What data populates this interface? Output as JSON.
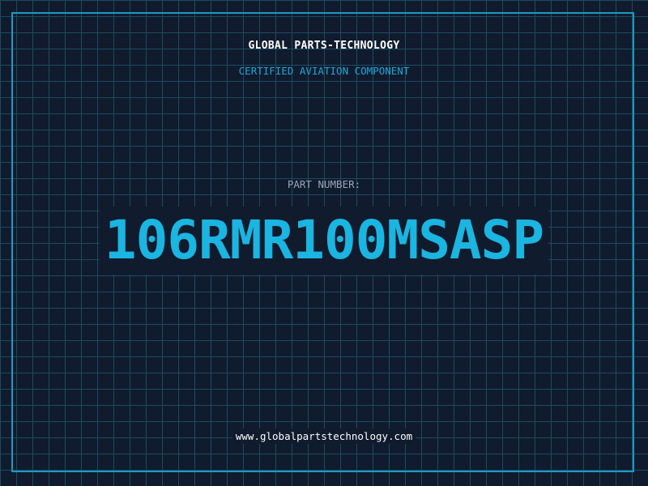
{
  "brand": {
    "name": "GLOBAL PARTS-TECHNOLOGY",
    "tagline": "CERTIFIED AVIATION COMPONENT"
  },
  "part": {
    "label": "PART NUMBER:",
    "number": "106RMR100MSASP"
  },
  "footer": {
    "url": "www.globalpartstechnology.com"
  },
  "colors": {
    "background": "#101b2e",
    "grid": "#1e4a60",
    "border": "#1b9bc4",
    "accent": "#1ab5e0",
    "label": "#9aa6b8",
    "text": "#ffffff"
  }
}
